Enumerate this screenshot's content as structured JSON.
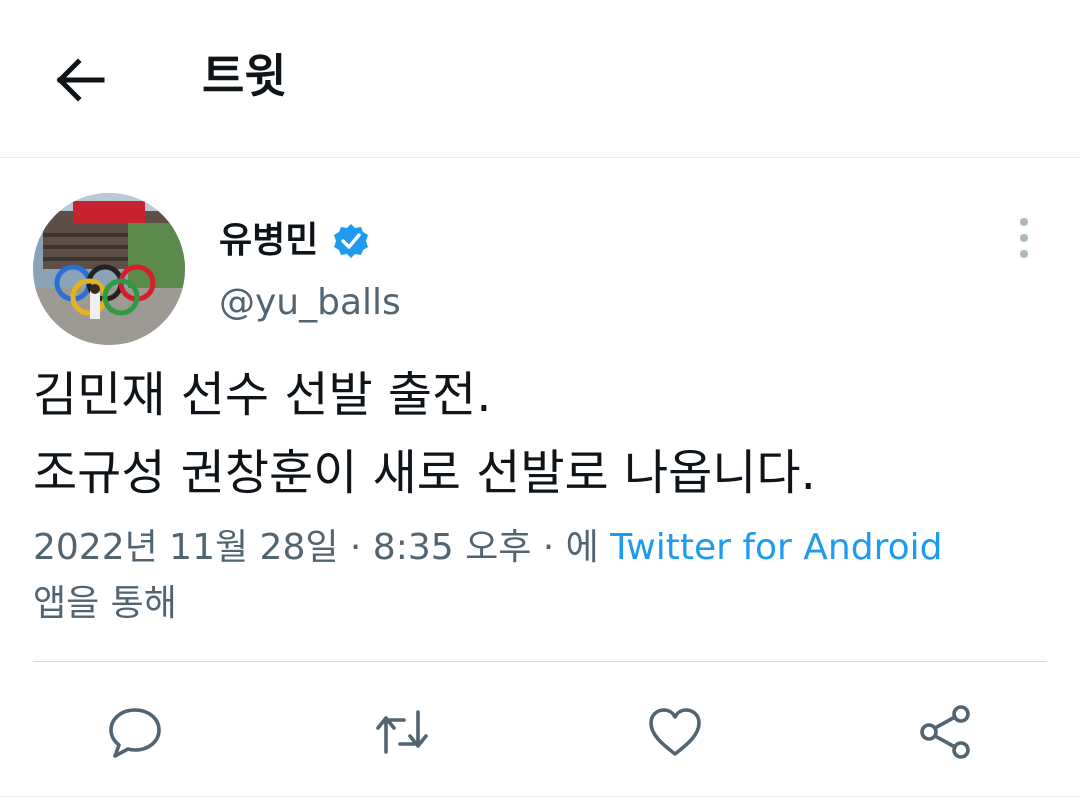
{
  "header": {
    "back_icon": "arrow-left-icon",
    "title": "트윗"
  },
  "tweet": {
    "author": {
      "display_name": "유병민",
      "handle": "@yu_balls",
      "verified": true,
      "verified_color": "#1d9bf0"
    },
    "text_lines": [
      "김민재 선수 선발 출전.",
      "조규성 권창훈이 새로 선발로 나옵니다."
    ],
    "meta": {
      "timestamp": "2022년 11월 28일 · 8:35 오후 · 에",
      "source": "Twitter for Android",
      "via": "앱을 통해"
    }
  },
  "actions": {
    "reply_icon": "reply-icon",
    "retweet_icon": "retweet-icon",
    "like_icon": "heart-icon",
    "share_icon": "share-icon"
  },
  "colors": {
    "accent": "#1d9bf0",
    "secondary_text": "#536471",
    "icon": "#536471",
    "divider": "#cfd9de"
  }
}
